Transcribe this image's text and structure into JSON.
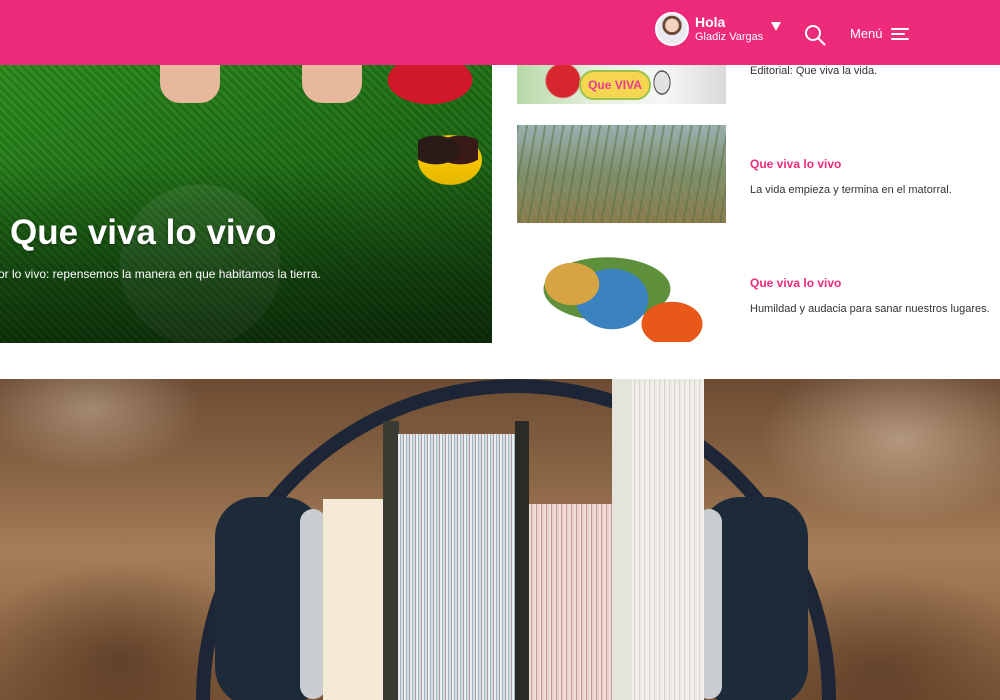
{
  "header": {
    "greeting": "Hola",
    "user_name": "Gladiz Vargas",
    "menu_label": "Menú",
    "bg_color": "#ee2a7b",
    "icons": [
      "chevron-down-icon",
      "search-icon",
      "hamburger-icon"
    ]
  },
  "hero": {
    "title": "Que viva lo vivo",
    "subtitle": "or lo vivo: repensemos la manera en que habitamos la tierra."
  },
  "articles": [
    {
      "category": "",
      "description": "Editorial: Que viva la vida.",
      "logo_text": "Que VIVA"
    },
    {
      "category": "Que viva lo vivo",
      "description": "La vida empieza y termina en el matorral."
    },
    {
      "category": "Que viva lo vivo",
      "description": "Humildad y audacia para sanar nuestros lugares."
    }
  ],
  "colors": {
    "accent": "#ee2a7b",
    "text": "#333333"
  }
}
